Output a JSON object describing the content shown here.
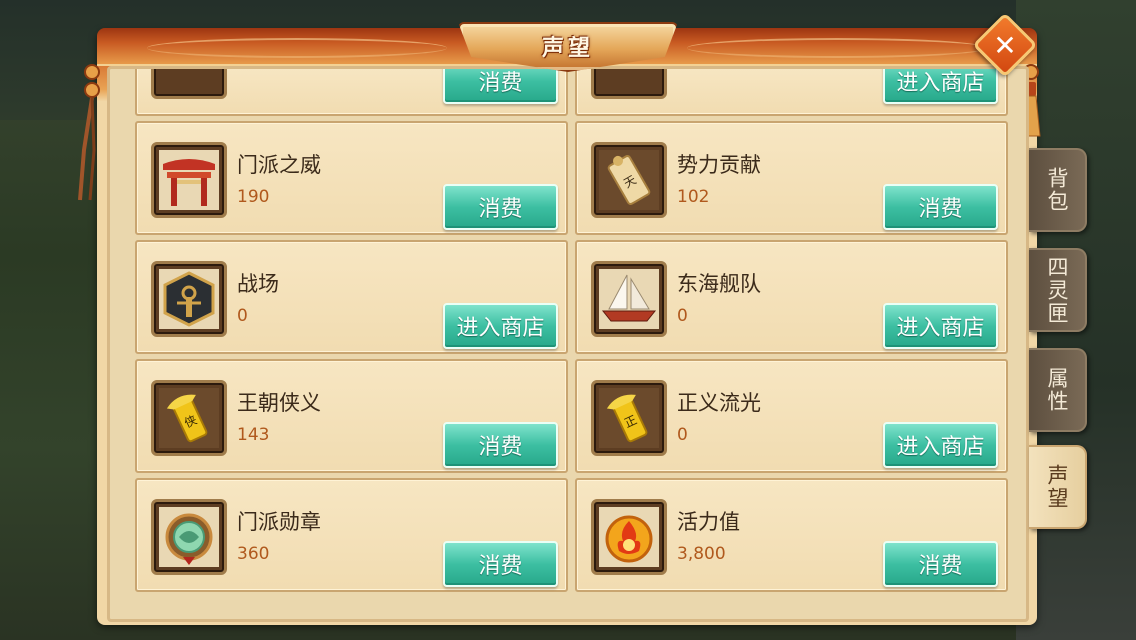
{
  "title": "声望",
  "close_icon": "close-icon",
  "tabs": [
    {
      "label": "背包",
      "active": false
    },
    {
      "label": "四灵匣",
      "active": false
    },
    {
      "label": "属性",
      "active": false
    },
    {
      "label": "声望",
      "active": true
    }
  ],
  "partial_row": [
    {
      "button": "消费",
      "icon": "reputation-icon"
    },
    {
      "button": "进入商店",
      "icon": "reputation-icon"
    }
  ],
  "items": [
    {
      "name": "门派之威",
      "value": "190",
      "button": "消费",
      "icon": "gate-icon"
    },
    {
      "name": "势力贡献",
      "value": "102",
      "button": "消费",
      "icon": "scroll-token-icon"
    },
    {
      "name": "战场",
      "value": "0",
      "button": "进入商店",
      "icon": "battle-emblem-icon"
    },
    {
      "name": "东海舰队",
      "value": "0",
      "button": "进入商店",
      "icon": "ship-icon"
    },
    {
      "name": "王朝侠义",
      "value": "143",
      "button": "消费",
      "icon": "gold-token-icon"
    },
    {
      "name": "正义流光",
      "value": "0",
      "button": "进入商店",
      "icon": "gold-token-icon"
    },
    {
      "name": "门派勋章",
      "value": "360",
      "button": "消费",
      "icon": "jade-medal-icon"
    },
    {
      "name": "活力值",
      "value": "3,800",
      "button": "消费",
      "icon": "flame-orb-icon"
    }
  ]
}
